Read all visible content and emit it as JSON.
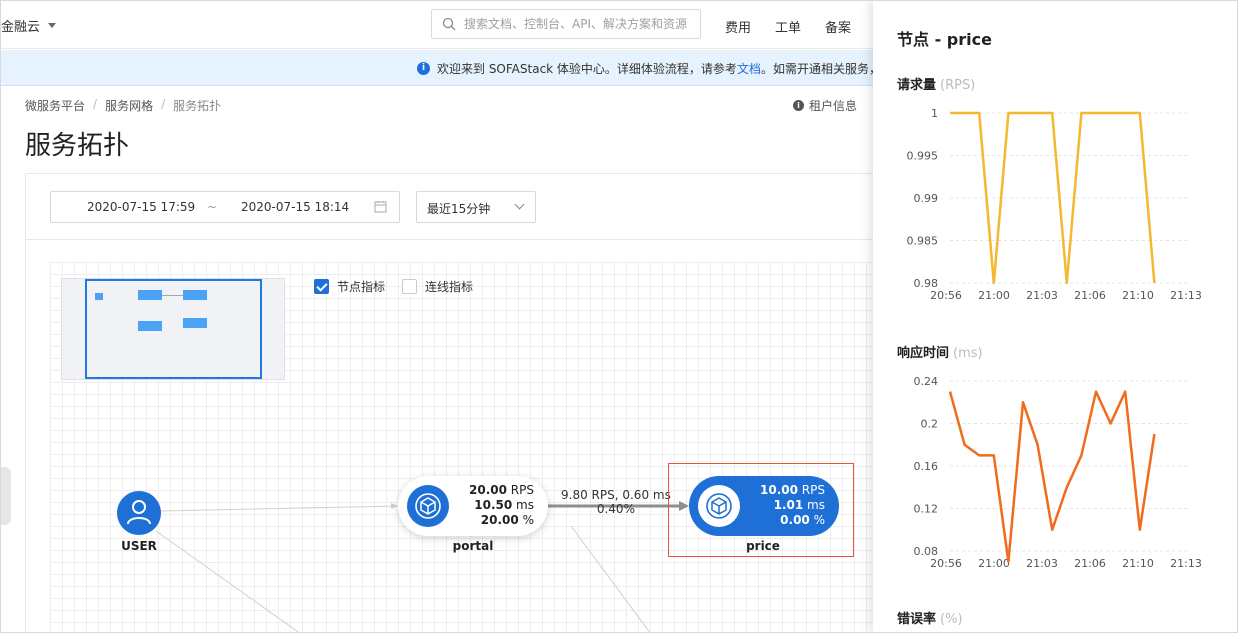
{
  "topbar": {
    "brand": "金融云",
    "search_placeholder": "搜索文档、控制台、API、解决方案和资源",
    "nav": [
      "费用",
      "工单",
      "备案"
    ]
  },
  "notice": {
    "text_before": "欢迎来到 SOFAStack 体验中心。详细体验流程，请参考",
    "link": "文档",
    "text_after": "。如需开通相关服务，"
  },
  "breadcrumb": [
    "微服务平台",
    "服务网格",
    "服务拓扑"
  ],
  "tenant_info": "租户信息",
  "page_title": "服务拓扑",
  "filters": {
    "start": "2020-07-15 17:59",
    "tilde": "~",
    "end": "2020-07-15 18:14",
    "quick_range": "最近15分钟"
  },
  "toggles": {
    "node_metrics": {
      "label": "节点指标",
      "checked": true
    },
    "edge_metrics": {
      "label": "连线指标",
      "checked": false
    }
  },
  "nodes": {
    "user": {
      "label": "USER"
    },
    "portal": {
      "label": "portal",
      "rps": "20.00",
      "rps_unit": "RPS",
      "ms": "10.50",
      "ms_unit": "ms",
      "err": "20.00",
      "err_unit": "%"
    },
    "price": {
      "label": "price",
      "rps": "10.00",
      "rps_unit": "RPS",
      "ms": "1.01",
      "ms_unit": "ms",
      "err": "0.00",
      "err_unit": "%"
    }
  },
  "edge_portal_price": {
    "line1": "9.80 RPS, 0.60 ms",
    "line2": "0.40%"
  },
  "drawer": {
    "title": "节点 - price",
    "sections": {
      "rps": {
        "label": "请求量",
        "unit": "(RPS)"
      },
      "latency": {
        "label": "响应时间",
        "unit": "(ms)"
      },
      "error": {
        "label": "错误率",
        "unit": "(%)"
      }
    }
  },
  "chart_data": [
    {
      "type": "line",
      "title": "请求量 (RPS)",
      "color": "#f5b82e",
      "x_ticks": [
        "20:56",
        "21:00",
        "21:03",
        "21:06",
        "21:10",
        "21:13"
      ],
      "y_ticks": [
        "1",
        "0.995",
        "0.99",
        "0.985",
        "0.98"
      ],
      "ylim": [
        0.98,
        1
      ],
      "x": [
        0,
        1,
        2,
        3,
        4,
        5,
        6,
        7,
        8,
        9,
        10,
        11,
        12,
        13,
        14
      ],
      "values": [
        1,
        1,
        1,
        0.98,
        1,
        1,
        1,
        1,
        0.98,
        1,
        1,
        1,
        1,
        1,
        0.98
      ]
    },
    {
      "type": "line",
      "title": "响应时间 (ms)",
      "color": "#f26a1b",
      "x_ticks": [
        "20:56",
        "21:00",
        "21:03",
        "21:06",
        "21:10",
        "21:13"
      ],
      "y_ticks": [
        "0.24",
        "0.2",
        "0.16",
        "0.12",
        "0.08"
      ],
      "ylim": [
        0.08,
        0.24
      ],
      "x": [
        0,
        1,
        2,
        3,
        4,
        5,
        6,
        7,
        8,
        9,
        10,
        11,
        12,
        13,
        14,
        15,
        16,
        17
      ],
      "values": [
        0.23,
        0.18,
        0.17,
        0.17,
        0.07,
        0.22,
        0.18,
        0.1,
        0.14,
        0.17,
        0.23,
        0.2,
        0.23,
        0.1,
        0.19
      ]
    }
  ]
}
